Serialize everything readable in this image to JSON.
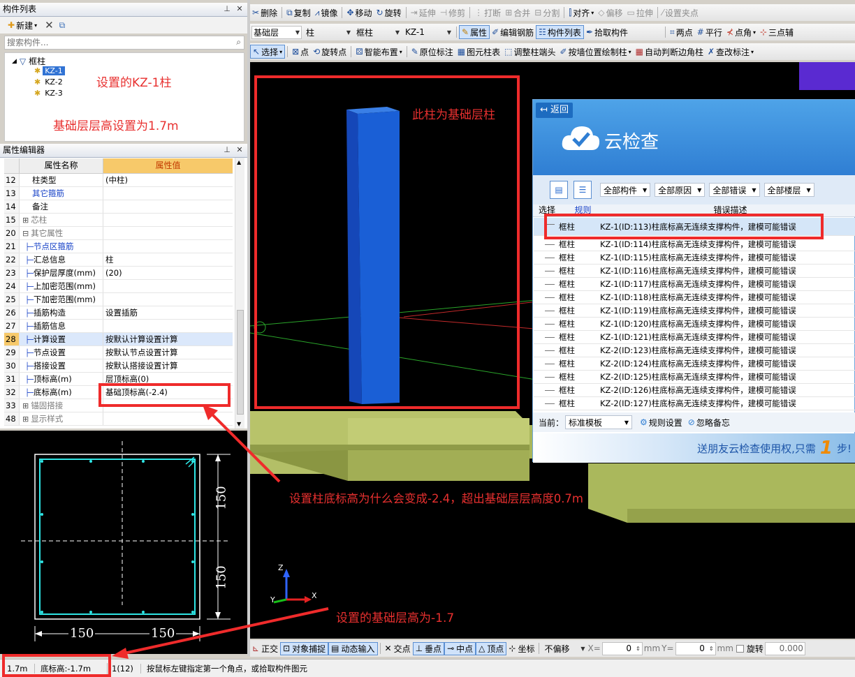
{
  "comp_list": {
    "title": "构件列表",
    "new_label": "新建",
    "search_placeholder": "搜索构件...",
    "root": "框柱",
    "items": [
      "KZ-1",
      "KZ-2",
      "KZ-3"
    ]
  },
  "toolbar1": {
    "items": [
      "删除",
      "复制",
      "镜像",
      "移动",
      "旋转",
      "延伸",
      "修剪",
      "打断",
      "合并",
      "分割",
      "对齐",
      "偏移",
      "拉伸",
      "设置夹点"
    ]
  },
  "toolbar2": {
    "layer": "基础层",
    "type": "柱",
    "comp": "框柱",
    "name": "KZ-1",
    "items": [
      "属性",
      "编辑钢筋",
      "构件列表",
      "拾取构件",
      "两点",
      "平行",
      "点角",
      "三点辅"
    ]
  },
  "toolbar3": {
    "items": [
      "选择",
      "点",
      "旋转点",
      "智能布置",
      "原位标注",
      "图元柱表",
      "调整柱端头",
      "按墙位置绘制柱",
      "自动判断边角柱",
      "查改标注"
    ]
  },
  "prop_editor": {
    "title": "属性编辑器",
    "col_name": "属性名称",
    "col_value": "属性值",
    "rows": [
      {
        "n": "12",
        "k": "柱类型",
        "v": "(中柱)"
      },
      {
        "n": "13",
        "k": "其它箍筋",
        "v": ""
      },
      {
        "n": "14",
        "k": "备注",
        "v": ""
      },
      {
        "n": "15",
        "k": "芯柱",
        "v": ""
      },
      {
        "n": "20",
        "k": "其它属性",
        "v": ""
      },
      {
        "n": "21",
        "k": "节点区箍筋",
        "v": ""
      },
      {
        "n": "22",
        "k": "汇总信息",
        "v": "柱"
      },
      {
        "n": "23",
        "k": "保护层厚度(mm)",
        "v": "(20)"
      },
      {
        "n": "24",
        "k": "上加密范围(mm)",
        "v": ""
      },
      {
        "n": "25",
        "k": "下加密范围(mm)",
        "v": ""
      },
      {
        "n": "26",
        "k": "插筋构造",
        "v": "设置插筋"
      },
      {
        "n": "27",
        "k": "插筋信息",
        "v": ""
      },
      {
        "n": "28",
        "k": "计算设置",
        "v": "按默认计算设置计算"
      },
      {
        "n": "29",
        "k": "节点设置",
        "v": "按默认节点设置计算"
      },
      {
        "n": "30",
        "k": "搭接设置",
        "v": "按默认搭接设置计算"
      },
      {
        "n": "31",
        "k": "顶标高(m)",
        "v": "层顶标高(0)"
      },
      {
        "n": "32",
        "k": "底标高(m)",
        "v": "基础顶标高(-2.4)"
      },
      {
        "n": "33",
        "k": "锚固搭接",
        "v": ""
      },
      {
        "n": "48",
        "k": "显示样式",
        "v": ""
      }
    ]
  },
  "section": {
    "dim1": "150",
    "dim2": "150",
    "dim3": "150",
    "dim4": "150"
  },
  "cloud": {
    "back": "返回",
    "title": "云检查",
    "filters": [
      "全部构件",
      "全部原因",
      "全部错误",
      "全部楼层"
    ],
    "col_select": "选择",
    "col_rule": "规则",
    "col_desc": "错误描述",
    "rows": [
      {
        "rule": "框柱",
        "desc": "KZ-1(ID:113)柱底标高无连续支撑构件，建模可能错误"
      },
      {
        "rule": "框柱",
        "desc": "KZ-1(ID:114)柱底标高无连续支撑构件，建模可能错误"
      },
      {
        "rule": "框柱",
        "desc": "KZ-1(ID:115)柱底标高无连续支撑构件，建模可能错误"
      },
      {
        "rule": "框柱",
        "desc": "KZ-1(ID:116)柱底标高无连续支撑构件，建模可能错误"
      },
      {
        "rule": "框柱",
        "desc": "KZ-1(ID:117)柱底标高无连续支撑构件，建模可能错误"
      },
      {
        "rule": "框柱",
        "desc": "KZ-1(ID:118)柱底标高无连续支撑构件，建模可能错误"
      },
      {
        "rule": "框柱",
        "desc": "KZ-1(ID:119)柱底标高无连续支撑构件，建模可能错误"
      },
      {
        "rule": "框柱",
        "desc": "KZ-1(ID:120)柱底标高无连续支撑构件，建模可能错误"
      },
      {
        "rule": "框柱",
        "desc": "KZ-1(ID:121)柱底标高无连续支撑构件，建模可能错误"
      },
      {
        "rule": "框柱",
        "desc": "KZ-2(ID:123)柱底标高无连续支撑构件，建模可能错误"
      },
      {
        "rule": "框柱",
        "desc": "KZ-2(ID:124)柱底标高无连续支撑构件，建模可能错误"
      },
      {
        "rule": "框柱",
        "desc": "KZ-2(ID:125)柱底标高无连续支撑构件，建模可能错误"
      },
      {
        "rule": "框柱",
        "desc": "KZ-2(ID:126)柱底标高无连续支撑构件，建模可能错误"
      },
      {
        "rule": "框柱",
        "desc": "KZ-2(ID:127)柱底标高无连续支撑构件，建模可能错误"
      }
    ],
    "current_label": "当前：",
    "template": "标准模板",
    "rule_settings": "规则设置",
    "ignore": "忽略备忘",
    "promo": "送朋友云检查使用权,只需",
    "promo_num": "1",
    "promo_tail": "步!"
  },
  "annotations": {
    "a1": "设置的KZ-1柱",
    "a2": "基础层层高设置为1.7m",
    "a3": "此柱为基础层柱",
    "a4": "设置柱底标高为什么会变成-2.4，超出基础层层高度0.7m",
    "a5": "设置的基础层高为-1.7"
  },
  "statusbar": {
    "s1": "1.7m",
    "s2": "底标高:-1.7m",
    "s3": "1(12)",
    "s4": "按鼠标左键指定第一个角点，或拾取构件图元",
    "items": [
      "正交",
      "对象捕捉",
      "动态输入",
      "交点",
      "垂点",
      "中点",
      "顶点",
      "坐标"
    ],
    "offset": "不偏移",
    "x_label": "X=",
    "x_val": "0",
    "unit1": "mm",
    "y_label": "Y=",
    "y_val": "0",
    "unit2": "mm",
    "rotate": "旋转",
    "rot_val": "0.000"
  },
  "colors": {
    "accent": "#ef2b2b",
    "column": "#1a5fd6",
    "base": "#a8b85a"
  }
}
